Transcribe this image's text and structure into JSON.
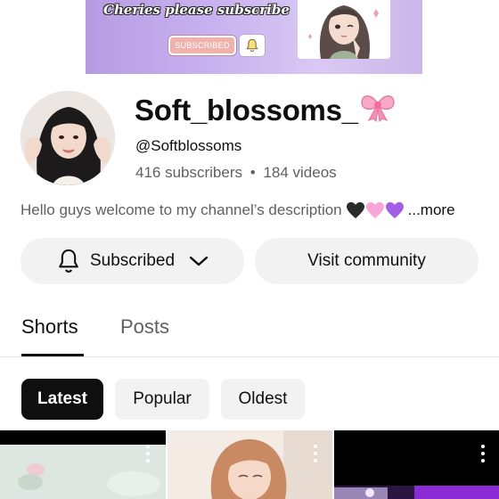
{
  "banner": {
    "text": "Cheries please subscribe",
    "button_label": "SUBSCRIBED"
  },
  "channel": {
    "name": "Soft_blossoms_",
    "name_emoji": "ribbon-bow",
    "handle": "@Softblossoms",
    "subscribers": "416 subscribers",
    "separator": "•",
    "videos": "184 videos",
    "description": "Hello guys welcome to my channel’s description",
    "description_emojis": [
      "black-heart",
      "pink-heart",
      "purple-heart"
    ],
    "more_label": "...more"
  },
  "actions": {
    "subscribed_label": "Subscribed",
    "community_label": "Visit community"
  },
  "tabs": [
    {
      "label": "Shorts",
      "active": true
    },
    {
      "label": "Posts",
      "active": false
    }
  ],
  "filters": [
    {
      "label": "Latest",
      "active": true
    },
    {
      "label": "Popular",
      "active": false
    },
    {
      "label": "Oldest",
      "active": false
    }
  ],
  "colors": {
    "banner_purple": "#c7b0ef",
    "chip_active": "#0f0f0f",
    "button_bg": "#f2f2f2",
    "secondary_text": "#606060"
  }
}
